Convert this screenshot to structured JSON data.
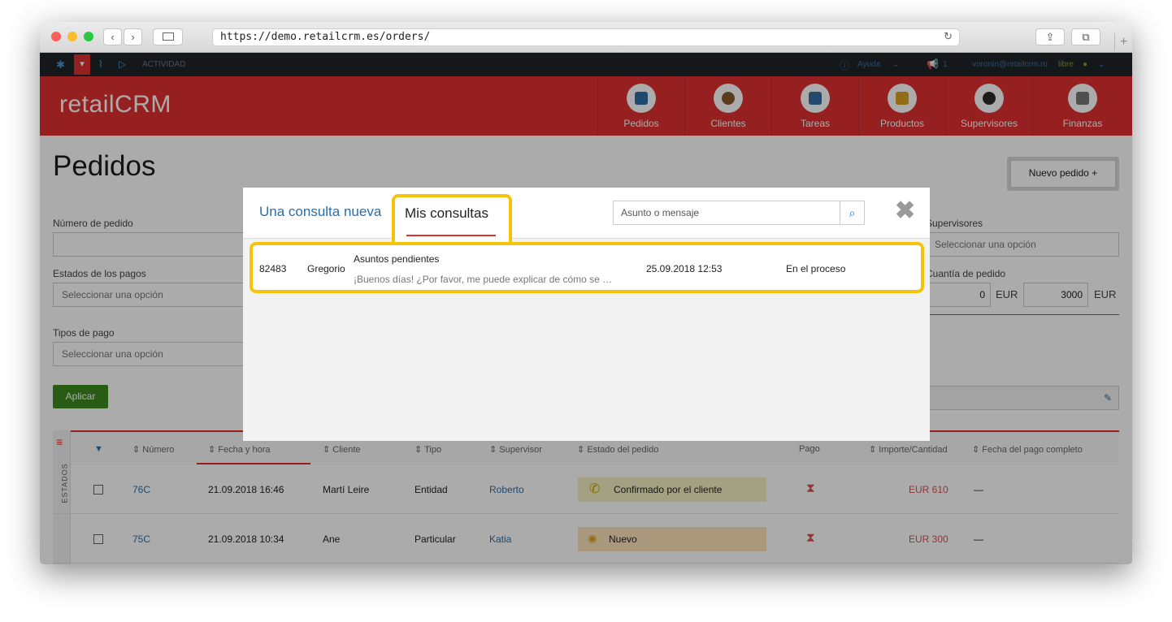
{
  "browser": {
    "url": "https://demo.retailcrm.es/orders/",
    "back_icon": "‹",
    "forward_icon": "›",
    "reload_icon": "↻",
    "new_tab_icon": "+"
  },
  "topbar": {
    "activity": "ACTIVIDAD",
    "help": "Ayuda",
    "notif_count": "1",
    "user_email": "voronin@retailcrm.ru",
    "user_status": "libre"
  },
  "header": {
    "logo": "retailCRM",
    "nav": [
      {
        "label": "Pedidos",
        "color": "#2e6da4"
      },
      {
        "label": "Clientes",
        "color": "#8a5a2b"
      },
      {
        "label": "Tareas",
        "color": "#3a6ea5"
      },
      {
        "label": "Productos",
        "color": "#d9a520"
      },
      {
        "label": "Supervisores",
        "color": "#2b2b2b"
      },
      {
        "label": "Finanzas",
        "color": "#777777"
      }
    ]
  },
  "page": {
    "title": "Pedidos",
    "new_order_button": "Nuevo pedido +"
  },
  "filters": {
    "order_number_label": "Número de pedido",
    "payment_states_label": "Estados de los pagos",
    "payment_states_placeholder": "Seleccionar una opción",
    "payment_types_label": "Tipos de pago",
    "payment_types_placeholder": "Seleccionar una opción",
    "supervisors_label": "Supervisores",
    "supervisors_placeholder": "Seleccionar una opción",
    "amount_label": "Cuantía de pedido",
    "amount_from": "0",
    "amount_to": "3000",
    "currency": "EUR",
    "apply_button": "Aplicar"
  },
  "table": {
    "side_label": "ESTADOS",
    "columns": [
      "Número",
      "Fecha y hora",
      "Cliente",
      "Tipo",
      "Supervisor",
      "Estado del pedido",
      "Pago",
      "Importe/Cantidad",
      "Fecha del pago completo"
    ],
    "rows": [
      {
        "number": "76C",
        "date": "21.09.2018 16:46",
        "client": "Martí Leire",
        "type": "Entidad",
        "supervisor": "Roberto",
        "status": "Confirmado por el cliente",
        "status_color": "#f3f0c0",
        "amount": "EUR 610",
        "paid_date": "—"
      },
      {
        "number": "75C",
        "date": "21.09.2018 10:34",
        "client": "Ane",
        "type": "Particular",
        "supervisor": "Katia",
        "status": "Nuevo",
        "status_color": "#fde3b8",
        "amount": "EUR 300",
        "paid_date": "—"
      }
    ]
  },
  "modal": {
    "tab_new": "Una consulta nueva",
    "tab_mine": "Mis consultas",
    "search_placeholder": "Asunto o mensaje",
    "close_icon": "✖",
    "consultation": {
      "id": "82483",
      "author": "Gregorio",
      "subject": "Asuntos pendientes",
      "message": "¡Buenos días! ¿Por favor, me puede explicar de cómo se …",
      "date": "25.09.2018 12:53",
      "status": "En el proceso"
    }
  }
}
